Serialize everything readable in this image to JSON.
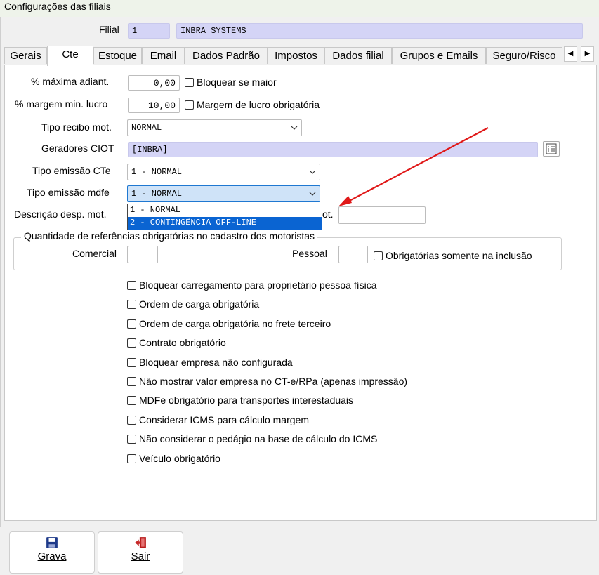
{
  "window": {
    "title": "Configurações das filiais"
  },
  "filial": {
    "label": "Filial",
    "code": "1",
    "name": "INBRA SYSTEMS"
  },
  "tabs": [
    {
      "label": "Gerais"
    },
    {
      "label": "Cte"
    },
    {
      "label": "Estoque"
    },
    {
      "label": "Email"
    },
    {
      "label": "Dados Padrão"
    },
    {
      "label": "Impostos"
    },
    {
      "label": "Dados filial"
    },
    {
      "label": "Grupos e Emails"
    },
    {
      "label": "Seguro/Risco"
    }
  ],
  "active_tab": "Cte",
  "form": {
    "max_adiant_label": "% máxima adiant.",
    "max_adiant_value": "0,00",
    "bloquear_maior_label": "Bloquear se maior",
    "margem_label": "% margem min. lucro",
    "margem_value": "10,00",
    "margem_obrig_label": "Margem de lucro obrigatória",
    "tipo_recibo_label": "Tipo recibo mot.",
    "tipo_recibo_value": "NORMAL",
    "geradores_label": "Geradores CIOT",
    "geradores_value": "[INBRA]",
    "tipo_emissao_cte_label": "Tipo emissão CTe",
    "tipo_emissao_cte_value": "1 - NORMAL",
    "tipo_emissao_mdfe_label": "Tipo emissão mdfe",
    "tipo_emissao_mdfe_value": "1 - NORMAL",
    "descricao_label": "Descrição desp. mot.",
    "descricao_suffix": "ot.",
    "mdfe_options": [
      "1 - NORMAL",
      "2 - CONTINGÊNCIA OFF-LINE"
    ]
  },
  "group": {
    "title": "Quantidade de referências obrigatórias no cadastro dos motoristas",
    "comercial_label": "Comercial",
    "pessoal_label": "Pessoal",
    "inclusao_label": "Obrigatórias somente na inclusão"
  },
  "checkboxes": [
    "Bloquear carregamento para proprietário pessoa física",
    "Ordem de carga obrigatória",
    "Ordem de carga obrigatória no frete terceiro",
    "Contrato obrigatório",
    "Bloquear empresa não configurada",
    "Não mostrar valor empresa no CT-e/RPa (apenas impressão)",
    "MDFe obrigatório para transportes interestaduais",
    "Considerar ICMS para cálculo margem",
    "Não considerar o pedágio na base de cálculo do ICMS",
    "Veículo obrigatório"
  ],
  "buttons": {
    "grava": "Grava",
    "sair": "Sair"
  },
  "colors": {
    "lavender_field": "#d4d4f6",
    "selection": "#0a64d2",
    "arrow": "#e01818"
  }
}
